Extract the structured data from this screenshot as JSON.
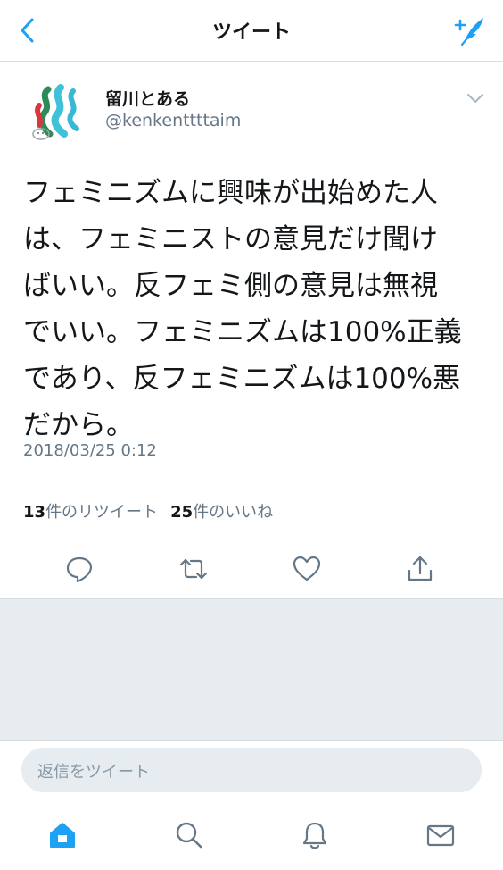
{
  "header": {
    "title": "ツイート"
  },
  "tweet": {
    "display_name": "留川とある",
    "handle": "@kenkenttttaim",
    "text": "フェミニズムに興味が出始めた人\nは、フェミニストの意見だけ聞け\nばいい。反フェミ側の意見は無視\nでいい。フェミニズムは100%正義\nであり、反フェミニズムは100%悪\nだから。",
    "timestamp": "2018/03/25 0:12"
  },
  "stats": {
    "retweet_count": "13",
    "retweet_label": "件のリツイート",
    "like_count": "25",
    "like_label": "件のいいね"
  },
  "actions": [
    "reply-icon",
    "retweet-icon",
    "like-icon",
    "share-icon"
  ],
  "reply": {
    "placeholder": "返信をツイート"
  },
  "tabbar": [
    "home-icon",
    "search-icon",
    "notifications-icon",
    "messages-icon"
  ],
  "colors": {
    "accent": "#1da1f2",
    "secondary_text": "#657786",
    "icon_gray": "#657786",
    "gray_background": "#e6ecf0"
  }
}
